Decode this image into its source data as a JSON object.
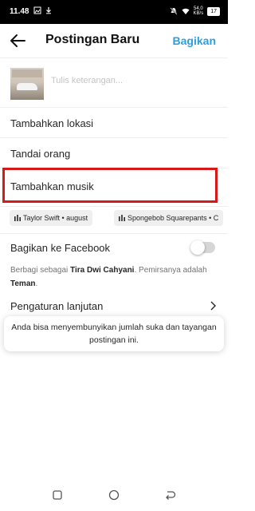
{
  "status_bar": {
    "time": "11.48",
    "network_speed_value": "54,0",
    "network_speed_unit": "KB/s",
    "battery": "17"
  },
  "header": {
    "title": "Postingan Baru",
    "share_label": "Bagikan"
  },
  "caption": {
    "placeholder": "Tulis keterangan..."
  },
  "menu": {
    "add_location": "Tambahkan lokasi",
    "tag_people": "Tandai orang",
    "add_music": "Tambahkan musik"
  },
  "music_suggestions": [
    {
      "label": "Taylor Swift • august"
    },
    {
      "label": "Spongebob Squarepants • C"
    }
  ],
  "facebook": {
    "label": "Bagikan ke Facebook",
    "toggle_on": false,
    "desc_prefix": "Berbagi sebagai ",
    "user_name": "Tira Dwi Cahyani",
    "desc_middle": ". Pemirsanya adalah ",
    "audience": "Teman",
    "desc_suffix": "."
  },
  "advanced": {
    "label": "Pengaturan lanjutan"
  },
  "tooltip": {
    "text": "Anda bisa menyembunyikan jumlah suka dan tayangan postingan ini."
  },
  "colors": {
    "accent": "#2a9fe0",
    "highlight": "#d81919"
  }
}
